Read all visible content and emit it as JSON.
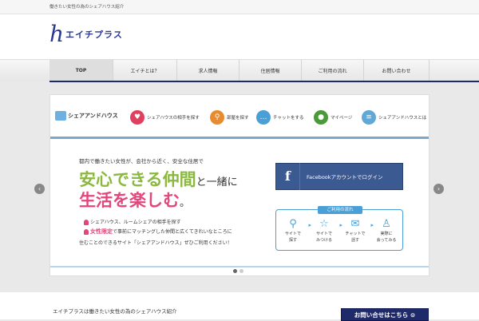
{
  "topbar": {
    "tagline": "働きたい女性の為のシェアハウス紹介"
  },
  "logo": {
    "mark": "h",
    "text": "エイチプラス"
  },
  "nav": {
    "items": [
      "TOP",
      "エイチとは？",
      "求人情報",
      "住居情報",
      "ご利用の流れ",
      "お問い合わせ"
    ]
  },
  "hero": {
    "brand": "シェアアンドハウス",
    "menu": [
      {
        "label": "シェアハウスの相手を探す",
        "icon": "♥",
        "color": "#e0405f"
      },
      {
        "label": "部屋を探す",
        "icon": "⚲",
        "color": "#e88a2e"
      },
      {
        "label": "チャットをする",
        "icon": "…",
        "color": "#4a9fd6"
      },
      {
        "label": "マイページ",
        "icon": "●",
        "color": "#4a9a3a"
      },
      {
        "label": "シェアアンドハウスとは",
        "icon": "≡",
        "color": "#5fa8d8"
      }
    ],
    "eyebrow": "都内で働きたい女性が、会社から近く、安全な住居で",
    "headline1": "安心できる仲間",
    "headline1_small": "と一緒に",
    "headline2": "生活を楽しむ",
    "headline2_small": "。",
    "desc1": "シェアハウス、ルームシェアの相手を探す",
    "desc2_strong": "女性限定",
    "desc2": "で事前にマッチングした仲間と広くてきれいなところに",
    "desc3": "住むことのできるサイト「シェアアンドハウス」ぜひご利用ください！",
    "facebook_icon": "f",
    "facebook_label": "Facebookアカウントでログイン",
    "flow_title": "ご利用の流れ",
    "flow_steps": [
      {
        "icon": "⚲",
        "label1": "サイトで",
        "label2": "探す"
      },
      {
        "icon": "☆",
        "label1": "サイトで",
        "label2": "みつける"
      },
      {
        "icon": "✉",
        "label1": "チャットで",
        "label2": "話す"
      },
      {
        "icon": "♙",
        "label1": "実際に",
        "label2": "会ってみる"
      }
    ],
    "flow_arrow": "▸",
    "prev_arrow": "‹",
    "next_arrow": "›"
  },
  "footer": {
    "text": "エイチプラスは働きたい女性の為のシェアハウス紹介",
    "contact": "お問い合せはこちら ⊙"
  }
}
